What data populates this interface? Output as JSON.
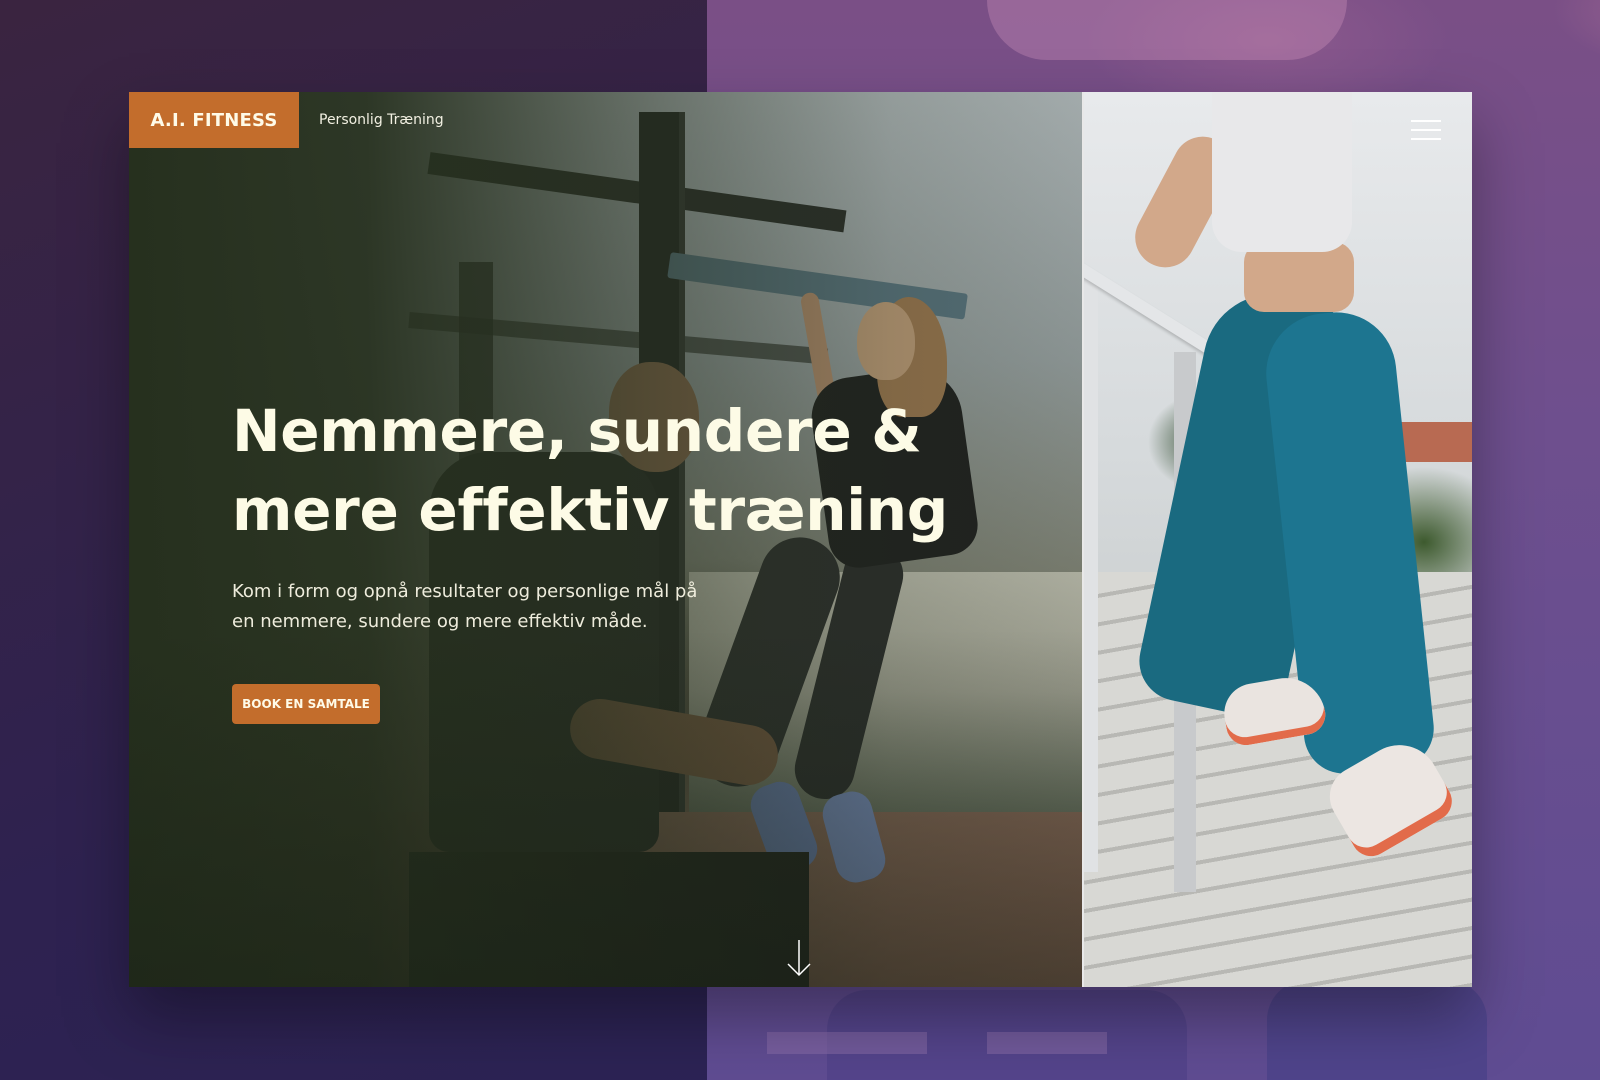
{
  "header": {
    "brand": "A.I. FITNESS",
    "tagline": "Personlig Træning",
    "menu_icon": "hamburger-menu-icon"
  },
  "hero": {
    "headline_line1": "Nemmere, sundere &",
    "headline_line2": "mere effektiv træning",
    "subtext_line1": "Kom i form og opnå resultater og personlige mål på",
    "subtext_line2": "en nemmere, sundere og mere effektiv måde.",
    "cta_label": "BOOK EN SAMTALE",
    "scroll_icon": "arrow-down-icon"
  },
  "colors": {
    "accent": "#c36d2c",
    "hero_overlay": "#26301e",
    "headline_text": "#fdfbe6",
    "background": "#2e2250",
    "background_right": "#6e4f8e"
  }
}
